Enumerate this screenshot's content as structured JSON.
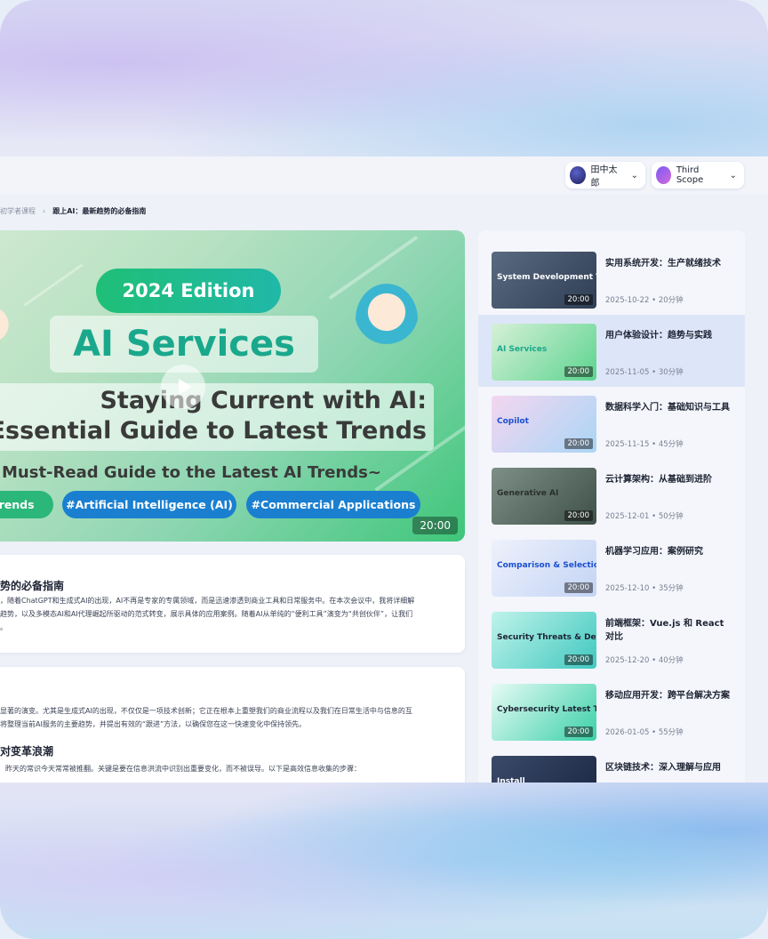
{
  "header": {
    "user_name": "田中太郎",
    "scope_name": "Third Scope"
  },
  "breadcrumb": {
    "parent": "初学者课程",
    "separator": "›",
    "current": "跟上AI：最新趋势的必备指南"
  },
  "video": {
    "edition": "2024 Edition",
    "headline": "AI Services",
    "title_line1": "Staying Current with AI:",
    "title_line2": "Essential Guide to Latest Trends",
    "subtitle": "Must-Read Guide to the Latest AI Trends~",
    "tags": [
      "Trends",
      "#Artificial Intelligence (AI)",
      "#Commercial Applications"
    ],
    "duration": "20:00"
  },
  "description": {
    "title": "势的必备指南",
    "lines": [
      "，随着ChatGPT和生成式AI的出现，AI不再是专家的专属领域，而是迅速渗透到商业工具和日常服务中。在本次会议中，我将详细解",
      "趋势，以及多模态AI和AI代理崛起所驱动的范式转变，展示具体的应用案例。随着AI从单纯的“便利工具”演变为“共创伙伴”，让我们",
      "。"
    ]
  },
  "article": {
    "intro_lines": [
      "显著的演变。尤其是生成式AI的出现，不仅仅是一项技术创新；它正在根本上重塑我们的商业流程以及我们在日常生活中与信息的互",
      "将整理当前AI服务的主要趋势，并提出有效的“跟进”方法，以确保您在这一快速变化中保持领先。"
    ],
    "section_title": "对变革浪潮",
    "section_text": "昨天的常识今天常常被推翻。关键是要在信息洪流中识别出重要变化，而不被误导。以下是高效信息收集的步骤："
  },
  "playlist": [
    {
      "title": "实用系统开发：生产就绪技术",
      "meta": "2025-10-22 • 20分钟",
      "duration": "20:00",
      "thumb_label": "System Development Techniques",
      "active": false
    },
    {
      "title": "用户体验设计：趋势与实践",
      "meta": "2025-11-05 • 30分钟",
      "duration": "20:00",
      "thumb_label": "AI Services",
      "active": true
    },
    {
      "title": "数据科学入门：基础知识与工具",
      "meta": "2025-11-15 • 45分钟",
      "duration": "20:00",
      "thumb_label": "Copilot",
      "active": false
    },
    {
      "title": "云计算架构：从基础到进阶",
      "meta": "2025-12-01 • 50分钟",
      "duration": "20:00",
      "thumb_label": "Generative AI",
      "active": false
    },
    {
      "title": "机器学习应用：案例研究",
      "meta": "2025-12-10 • 35分钟",
      "duration": "20:00",
      "thumb_label": "Comparison & Selection Guide",
      "active": false
    },
    {
      "title": "前端框架：Vue.js 和 React 对比",
      "meta": "2025-12-20 • 40分钟",
      "duration": "20:00",
      "thumb_label": "Security Threats & Defensive Strategies",
      "active": false
    },
    {
      "title": "移动应用开发：跨平台解决方案",
      "meta": "2026-01-05 • 55分钟",
      "duration": "20:00",
      "thumb_label": "Cybersecurity Latest Trends and countermeasures",
      "active": false
    },
    {
      "title": "区块链技术：深入理解与应用",
      "meta": "",
      "duration": "",
      "thumb_label": "Install",
      "active": false
    }
  ]
}
